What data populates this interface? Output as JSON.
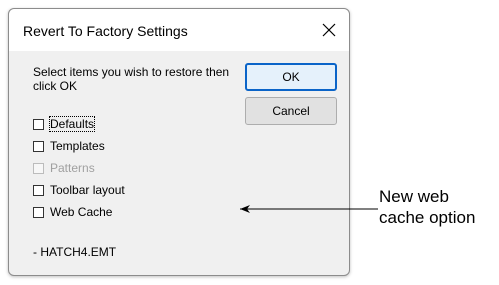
{
  "dialog": {
    "title": "Revert To Factory Settings",
    "close_glyph": "✕",
    "instruction": "Select items you wish to restore then click OK",
    "buttons": {
      "ok_label": "OK",
      "cancel_label": "Cancel"
    },
    "options": [
      {
        "label": "Defaults",
        "checked": false,
        "enabled": true,
        "focused": true
      },
      {
        "label": "Templates",
        "checked": false,
        "enabled": true,
        "focused": false
      },
      {
        "label": "Patterns",
        "checked": false,
        "enabled": false,
        "focused": false
      },
      {
        "label": "Toolbar layout",
        "checked": false,
        "enabled": true,
        "focused": false
      },
      {
        "label": "Web Cache",
        "checked": false,
        "enabled": true,
        "focused": false
      }
    ],
    "footer_text": "- HATCH4.EMT"
  },
  "annotation": {
    "line1": "New web",
    "line2": "cache option"
  },
  "icons": {
    "close": "close-icon",
    "arrow": "arrow-left-icon"
  },
  "colors": {
    "dialog_bg": "#f0f0f0",
    "titlebar_bg": "#ffffff",
    "ok_border": "#0a64c8",
    "disabled_text": "#a0a0a0"
  }
}
